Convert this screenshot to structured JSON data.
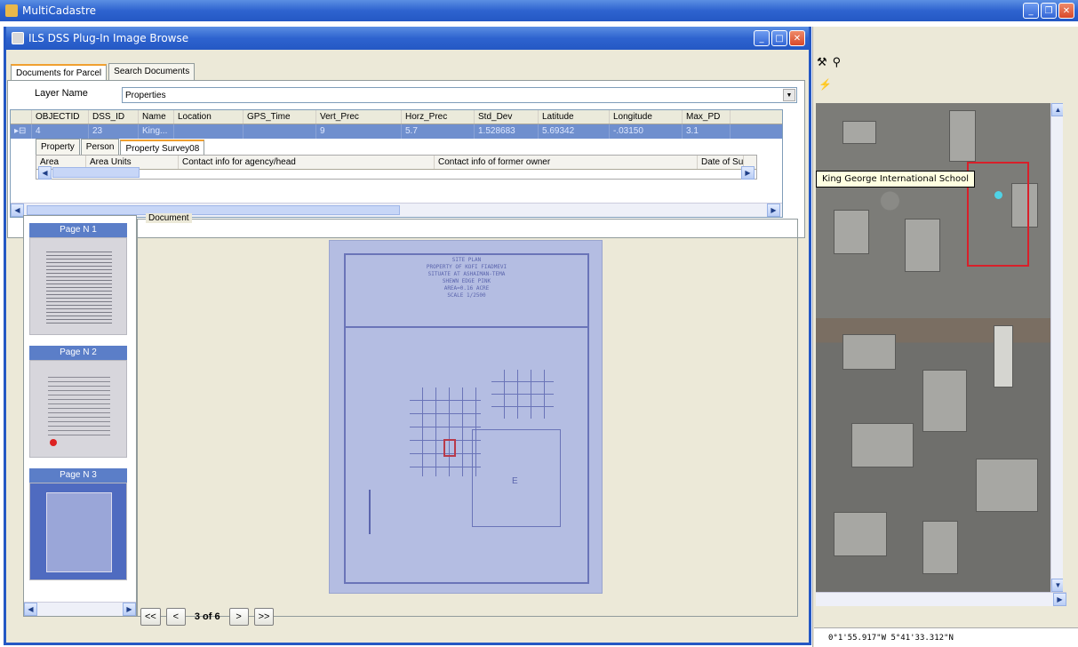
{
  "app": {
    "title": "MultiCadastre"
  },
  "dialog": {
    "title": "ILS DSS Plug-In Image Browse"
  },
  "tabs": [
    {
      "label": "Documents for Parcel"
    },
    {
      "label": "Search Documents"
    }
  ],
  "layer": {
    "label": "Layer Name",
    "value": "Properties"
  },
  "grid": {
    "columns": [
      "OBJECTID",
      "DSS_ID",
      "Name",
      "Location",
      "GPS_Time",
      "Vert_Prec",
      "Horz_Prec",
      "Std_Dev",
      "Latitude",
      "Longitude",
      "Max_PD"
    ],
    "row": [
      "4",
      "23",
      "King...",
      "",
      "",
      "9",
      "5.7",
      "1.528683",
      "5.69342",
      "-.03150",
      "3.1"
    ]
  },
  "subtabs": [
    {
      "label": "Property"
    },
    {
      "label": "Person"
    },
    {
      "label": "Property Survey08"
    }
  ],
  "subgrid": {
    "columns": [
      "Area",
      "Area Units",
      "Contact info for agency/head",
      "Contact info of former owner",
      "Date of Sur"
    ]
  },
  "thumbs": [
    {
      "label": "Page N 1"
    },
    {
      "label": "Page N 2"
    },
    {
      "label": "Page N 3"
    }
  ],
  "document": {
    "legend": "Document",
    "sheet_lines": [
      "SITE PLAN",
      "PROPERTY OF KOFI FIADMEVI",
      "SITUATE AT ASHAIMAN-TEMA",
      "SHEWN EDGE PINK",
      "AREA=0.16 ACRE",
      "SCALE 1/2500"
    ],
    "sheet_label": "E"
  },
  "nav": {
    "first": "<<",
    "prev": "<",
    "page_info": "3 of 6",
    "next": ">",
    "last": ">>"
  },
  "map": {
    "tooltip": "King George International School"
  },
  "status": {
    "coords": "0°1'55.917\"W 5°41'33.312\"N"
  }
}
